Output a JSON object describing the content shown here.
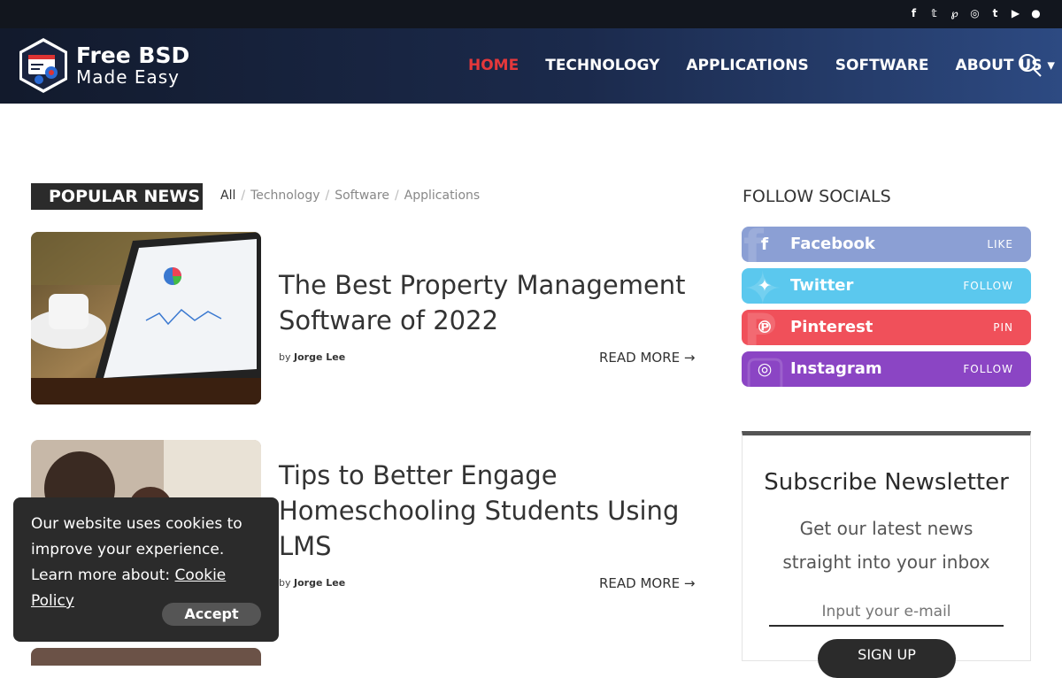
{
  "topbar": {
    "socials": [
      {
        "icon": "facebook-icon",
        "glyph": "f"
      },
      {
        "icon": "twitter-icon",
        "glyph": "t"
      },
      {
        "icon": "pinterest-icon",
        "glyph": "p"
      },
      {
        "icon": "instagram-icon",
        "glyph": "◎"
      },
      {
        "icon": "tumblr-icon",
        "glyph": "t"
      },
      {
        "icon": "youtube-icon",
        "glyph": "▶"
      },
      {
        "icon": "reddit-icon",
        "glyph": "●"
      }
    ]
  },
  "header": {
    "logo_line1": "Free BSD",
    "logo_line2": "Made Easy",
    "nav": [
      {
        "label": "HOME",
        "active": true
      },
      {
        "label": "TECHNOLOGY"
      },
      {
        "label": "APPLICATIONS"
      },
      {
        "label": "SOFTWARE"
      },
      {
        "label": "ABOUT US ▾"
      }
    ]
  },
  "popular": {
    "title": "POPULAR NEWS",
    "filters": [
      "All",
      "Technology",
      "Software",
      "Applications"
    ],
    "articles": [
      {
        "title": "The Best Property Management Software of 2022",
        "by": "by",
        "author": "Jorge Lee",
        "readmore": "READ MORE"
      },
      {
        "title": "Tips to Better Engage Homeschooling Students Using LMS",
        "by": "by",
        "author": "Jorge Lee",
        "readmore": "READ MORE"
      }
    ]
  },
  "sidebar": {
    "follow_title": "FOLLOW SOCIALS",
    "socials": [
      {
        "name": "Facebook",
        "action": "LIKE",
        "color": "#8b9fd4"
      },
      {
        "name": "Twitter",
        "action": "FOLLOW",
        "color": "#5bc8ee"
      },
      {
        "name": "Pinterest",
        "action": "PIN",
        "color": "#f0505a"
      },
      {
        "name": "Instagram",
        "action": "FOLLOW",
        "color": "#8b45c4"
      }
    ],
    "newsletter": {
      "title": "Subscribe Newsletter",
      "description": "Get our latest news straight into your inbox",
      "placeholder": "Input your e-mail",
      "button": "SIGN UP"
    }
  },
  "cookie": {
    "text": "Our website uses cookies to improve your experience. Learn more about:",
    "link": "Cookie Policy",
    "button": "Accept"
  }
}
